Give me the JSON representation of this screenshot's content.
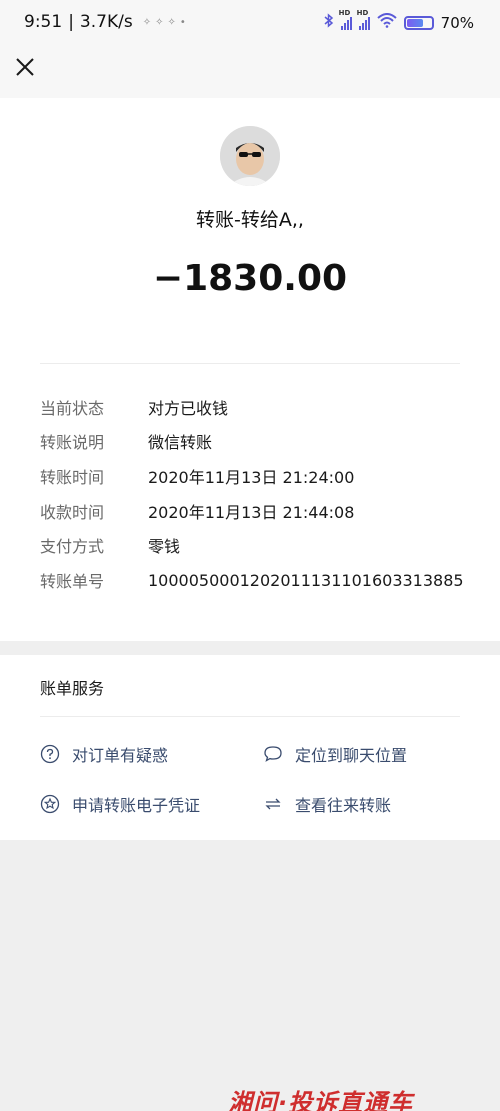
{
  "status_bar": {
    "time": "9:51",
    "speed": "3.7K/s",
    "net1": "HD",
    "net2": "HD",
    "battery": "70%"
  },
  "transfer": {
    "recipient": "转账-转给A,,",
    "amount": "−1830.00"
  },
  "details": [
    {
      "label": "当前状态",
      "value": "对方已收钱"
    },
    {
      "label": "转账说明",
      "value": "微信转账"
    },
    {
      "label": "转账时间",
      "value": "2020年11月13日 21:24:00"
    },
    {
      "label": "收款时间",
      "value": "2020年11月13日 21:44:08"
    },
    {
      "label": "支付方式",
      "value": "零钱"
    },
    {
      "label": "转账单号",
      "value": "1000050001202011131101603313885"
    }
  ],
  "services": {
    "title": "账单服务",
    "items": [
      {
        "label": "对订单有疑惑",
        "icon": "question-circle-icon"
      },
      {
        "label": "定位到聊天位置",
        "icon": "chat-bubble-icon"
      },
      {
        "label": "申请转账电子凭证",
        "icon": "star-circle-icon"
      },
      {
        "label": "查看往来转账",
        "icon": "swap-arrows-icon"
      }
    ]
  },
  "watermark": "湘问·投诉直通车",
  "colors": {
    "accent_text": "#3a4c6e",
    "status_icons": "#5a5ad8",
    "watermark": "#cf2e2e"
  }
}
